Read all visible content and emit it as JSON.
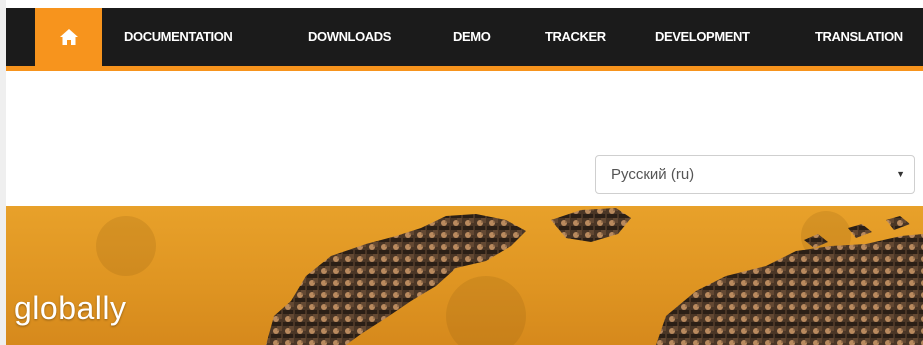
{
  "nav": {
    "home_icon": "home-icon",
    "items": [
      {
        "label": "DOCUMENTATION"
      },
      {
        "label": "DOWNLOADS"
      },
      {
        "label": "DEMO"
      },
      {
        "label": "TRACKER"
      },
      {
        "label": "DEVELOPMENT"
      },
      {
        "label": "TRANSLATION"
      }
    ]
  },
  "language_select": {
    "value": "Русский (ru)",
    "caret_icon": "caret-down-icon"
  },
  "hero": {
    "text": "globally"
  },
  "colors": {
    "accent": "#f7941d",
    "navbar": "#1b1b1b",
    "hero": "#e39a26"
  }
}
